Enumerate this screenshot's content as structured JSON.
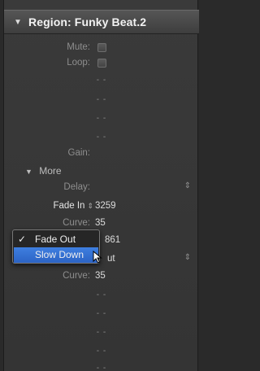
{
  "header": {
    "title": "Region: Funky Beat.2"
  },
  "mute_label": "Mute:",
  "loop_label": "Loop:",
  "gain_label": "Gain:",
  "more_label": "More",
  "delay_label": "Delay:",
  "fade_in": {
    "label": "Fade In",
    "value": "3259"
  },
  "curve1": {
    "label": "Curve:",
    "value": "35"
  },
  "hidden_value": "861",
  "out_value": "ut",
  "curve2": {
    "label": "Curve:",
    "value": "35"
  },
  "dash": "- -",
  "menu": {
    "checkmark": "✓",
    "items": [
      "Fade Out",
      "Slow Down"
    ]
  }
}
